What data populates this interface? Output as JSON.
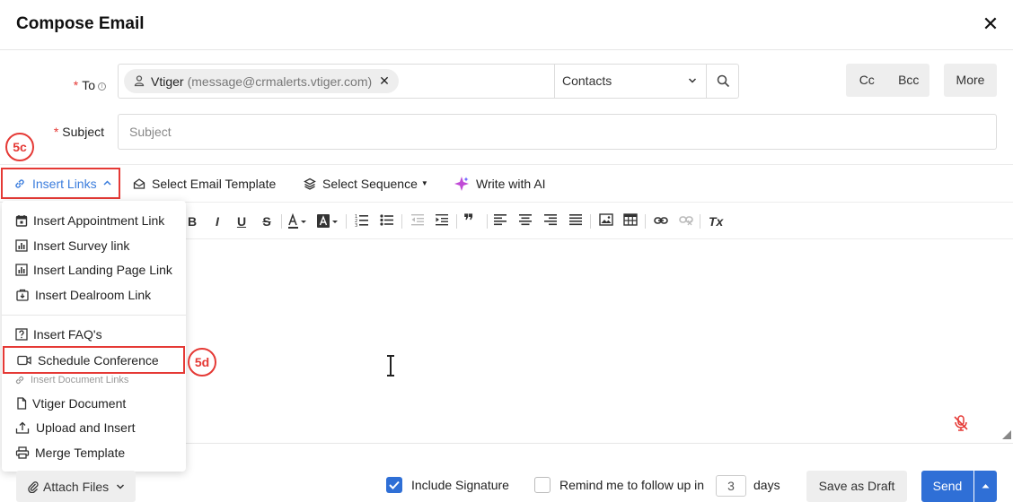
{
  "dialog": {
    "title": "Compose Email"
  },
  "to": {
    "label": "To",
    "recipient_name": "Vtiger",
    "recipient_email": "(message@crmalerts.vtiger.com)",
    "lookup_module": "Contacts",
    "cc_label": "Cc",
    "bcc_label": "Bcc",
    "more_label": "More"
  },
  "subject": {
    "label": "Subject",
    "placeholder": "Subject",
    "value": ""
  },
  "toolbar": {
    "insert_links": "Insert Links",
    "select_template": "Select Email Template",
    "select_sequence": "Select Sequence",
    "write_ai": "Write with AI"
  },
  "annotations": {
    "insert_links": "5c",
    "schedule_conference": "5d"
  },
  "dropdown": {
    "items": [
      {
        "label": "Insert Appointment Link",
        "icon": "calendar-icon"
      },
      {
        "label": "Insert Survey link",
        "icon": "bar-chart-icon"
      },
      {
        "label": "Insert Landing Page Link",
        "icon": "bar-chart-icon"
      },
      {
        "label": "Insert Dealroom Link",
        "icon": "dealroom-icon"
      },
      {
        "label": "Insert FAQ's",
        "icon": "question-icon"
      },
      {
        "label": "Schedule Conference",
        "icon": "video-icon"
      },
      {
        "label": "Vtiger Document",
        "icon": "document-icon"
      },
      {
        "label": "Upload and Insert",
        "icon": "upload-icon"
      },
      {
        "label": "Merge Template",
        "icon": "print-icon"
      }
    ],
    "section_label": "Insert Document Links"
  },
  "editor_toolbar": {
    "bold": "B",
    "italic": "I",
    "underline": "U",
    "strike": "S",
    "quote": "❞",
    "clear_format": "Tx"
  },
  "footer": {
    "attach_label": "Attach Files",
    "include_signature_label": "Include Signature",
    "include_signature_checked": true,
    "remind_label": "Remind me to follow up in",
    "remind_days": "3",
    "days_label": "days",
    "remind_checked": false,
    "save_draft_label": "Save as Draft",
    "send_label": "Send"
  },
  "colors": {
    "accent": "#2f6fd6",
    "annotation": "#e53935",
    "link": "#3b7ddd"
  }
}
